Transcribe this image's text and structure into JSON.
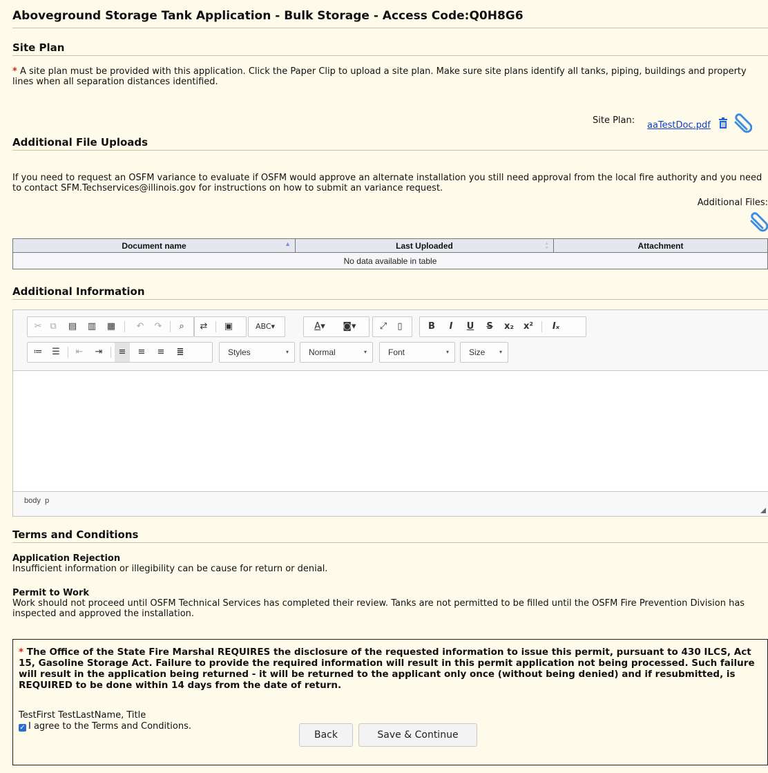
{
  "header": {
    "title": "Aboveground Storage Tank Application - Bulk Storage - Access Code:Q0H8G6"
  },
  "site_plan": {
    "heading": "Site Plan",
    "required_mark": "*",
    "note": "A site plan must be provided with this application. Click the Paper Clip to upload a site plan. Make sure site plans identify all tanks, piping, buildings and property lines when all separation distances identified.",
    "label": "Site Plan:",
    "file_name": "aaTestDoc.pdf",
    "icons": [
      "trash-icon",
      "paperclip-icon"
    ]
  },
  "additional_uploads": {
    "heading": "Additional File Uploads",
    "note": "If you need to request an OSFM variance to evaluate if OSFM would approve an alternate installation you still need approval from the local fire authority and you need to contact SFM.Techservices@illinois.gov for instructions on how to submit an variance request.",
    "label": "Additional Files:",
    "table": {
      "columns": [
        "Document name",
        "Last Uploaded",
        "Attachment"
      ],
      "empty_text": "No data available in table"
    }
  },
  "additional_info": {
    "heading": "Additional Information",
    "toolbar": {
      "styles": "Styles",
      "format": "Normal",
      "font": "Font",
      "size": "Size",
      "bold": "B",
      "italic": "I",
      "underline": "U",
      "strike": "S"
    },
    "path_body": "body",
    "path_p": "p"
  },
  "terms": {
    "heading": "Terms and Conditions",
    "rejection_title": "Application Rejection",
    "rejection_text": "Insufficient information or illegibility can be cause for return or denial.",
    "permit_title": "Permit to Work",
    "permit_text": "Work should not proceed until OSFM Technical Services has completed their review. Tanks are not permitted to be filled until the OSFM Fire Prevention Division has inspected and approved the installation.",
    "notice": "The Office of the State Fire Marshal REQUIRES the disclosure of the requested information to issue this permit, pursuant to 430 ILCS, Act 15, Gasoline Storage Act. Failure to provide the required information will result in this permit application not being processed. Such failure will result in the application being returned - it will be returned to the applicant only once (without being denied) and if resubmitted, is REQUIRED to be done within 14 days from the date of return.",
    "signer": "TestFirst TestLastName, Title",
    "agree_label": "I agree to the Terms and Conditions.",
    "agree_checked": true
  },
  "actions": {
    "back": "Back",
    "save": "Save & Continue"
  },
  "colors": {
    "page_bg": "#fffbeb",
    "required": "#e0201c",
    "link": "#0f3fc8",
    "clip": "#3f8de0",
    "checkbox": "#2a6fce"
  }
}
